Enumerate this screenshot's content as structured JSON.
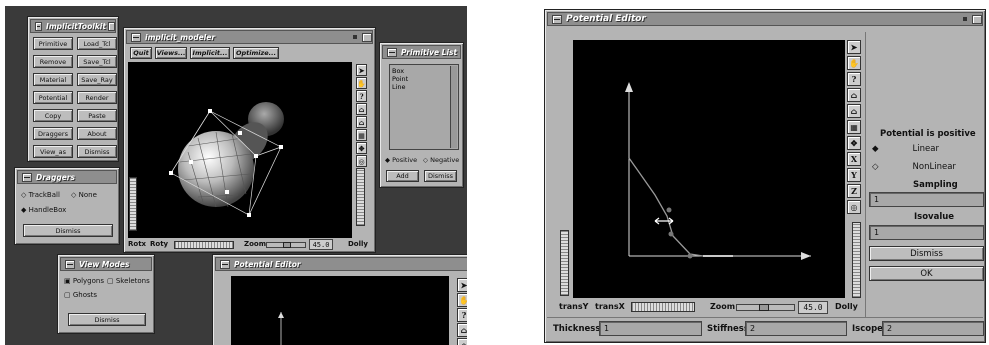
{
  "left": {
    "toolkit": {
      "title": "ImplicitToolkit",
      "buttons": [
        "Primitive",
        "Load_Tcl",
        "Remove",
        "Save_Tcl",
        "Material",
        "Save_Ray",
        "Potential",
        "Render",
        "Copy",
        "Paste",
        "Draggers",
        "About",
        "View_as",
        "Dismiss"
      ]
    },
    "draggers": {
      "title": "Draggers",
      "opt1": "TrackBall",
      "opt2": "None",
      "opt3": "HandleBox",
      "dismiss": "Dismiss"
    },
    "modeler": {
      "title": "implicit_modeler",
      "menu": [
        "Quit",
        "Views...",
        "Implicit...",
        "Optimize..."
      ],
      "rotx": "Rotx",
      "roty": "Roty",
      "zoom": "Zoom",
      "zoom_val": "45.0",
      "dolly": "Dolly",
      "tools": [
        "arrow-icon",
        "hand-icon",
        "help-icon",
        "home-icon",
        "set-home-icon",
        "view-all-icon",
        "seek-icon",
        "perspective-icon"
      ]
    },
    "primlist": {
      "title": "Primitive List",
      "items": [
        "Box",
        "Point",
        "Line"
      ],
      "pos": "Positive",
      "neg": "Negative",
      "add": "Add",
      "dismiss": "Dismiss"
    },
    "viewmodes": {
      "title": "View Modes",
      "opt1": "Polygons",
      "opt2": "Skeletons",
      "opt3": "Ghosts",
      "dismiss": "Dismiss"
    },
    "pe_small": {
      "title": "Potential Editor"
    }
  },
  "right": {
    "title": "Potential Editor",
    "tools": [
      "arrow-icon",
      "hand-icon",
      "help-icon",
      "home-icon",
      "set-home-icon",
      "view-all-icon",
      "seek-icon"
    ],
    "letters": [
      "X",
      "Y",
      "Z"
    ],
    "transY": "transY",
    "transX": "transX",
    "zoom": "Zoom",
    "zoom_val": "45.0",
    "dolly": "Dolly",
    "potential_label": "Potential is positive",
    "linear": "Linear",
    "nonlinear": "NonLinear",
    "sampling": "Sampling",
    "sampling_val": "1",
    "isovalue": "Isovalue",
    "isovalue_val": "1",
    "dismiss": "Dismiss",
    "ok": "OK",
    "thickness": "Thickness",
    "thickness_val": "1",
    "stiffness": "Stiffness",
    "stiffness_val": "2",
    "iscope": "Iscope",
    "iscope_val": "2"
  }
}
